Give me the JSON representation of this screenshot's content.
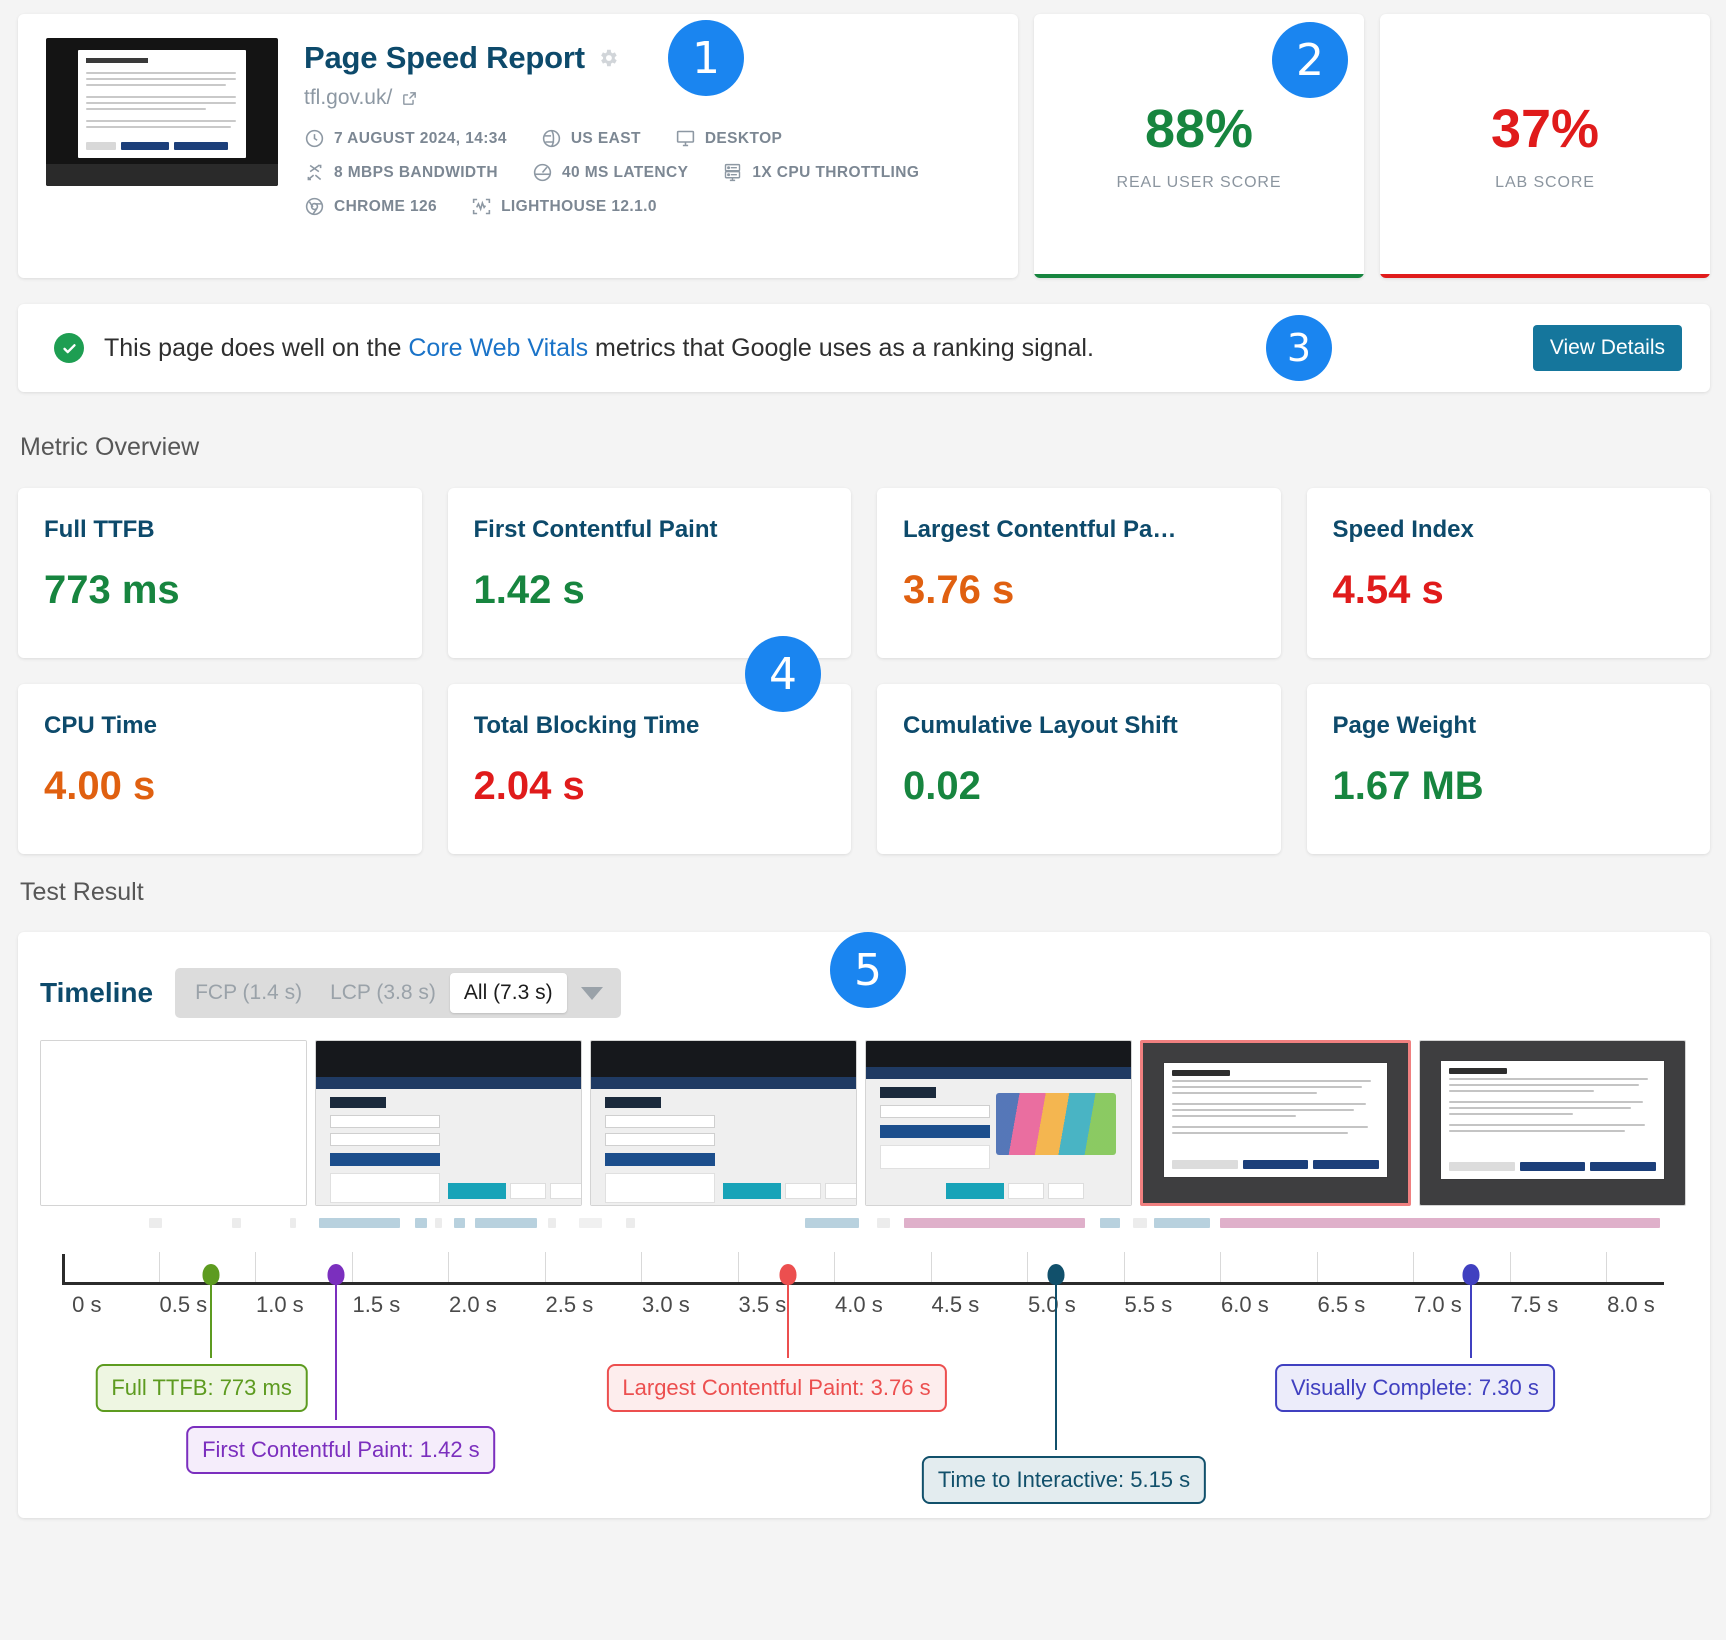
{
  "header": {
    "title": "Page Speed Report",
    "gear_icon": "gear-icon",
    "url": "tfl.gov.uk/",
    "external_icon": "external-link-icon",
    "meta": [
      {
        "icon": "clock-icon",
        "label": "7 AUGUST 2024, 14:34"
      },
      {
        "icon": "globe-icon",
        "label": "US EAST"
      },
      {
        "icon": "monitor-icon",
        "label": "DESKTOP"
      },
      {
        "icon": "bandwidth-icon",
        "label": "8 MBPS BANDWIDTH"
      },
      {
        "icon": "latency-icon",
        "label": "40 MS LATENCY"
      },
      {
        "icon": "cpu-icon",
        "label": "1X CPU THROTTLING"
      },
      {
        "icon": "chrome-icon",
        "label": "CHROME 126"
      },
      {
        "icon": "lighthouse-icon",
        "label": "LIGHTHOUSE 12.1.0"
      }
    ]
  },
  "scores": [
    {
      "value": "88%",
      "label": "REAL USER SCORE",
      "color": "#17853f"
    },
    {
      "value": "37%",
      "label": "LAB SCORE",
      "color": "#e01b1b"
    }
  ],
  "cwv": {
    "text_before": "This page does well on the ",
    "link": "Core Web Vitals",
    "text_after": " metrics that Google uses as a ranking signal.",
    "button": "View Details",
    "check_icon": "check-circle-icon"
  },
  "badges": [
    "1",
    "2",
    "3",
    "4",
    "5"
  ],
  "sections": {
    "metric_overview": "Metric Overview",
    "test_result": "Test Result"
  },
  "metrics": [
    {
      "label": "Full TTFB",
      "value": "773 ms",
      "color": "#17853f"
    },
    {
      "label": "First Contentful Paint",
      "value": "1.42 s",
      "color": "#17853f"
    },
    {
      "label": "Largest Contentful Pa…",
      "value": "3.76 s",
      "color": "#e06010"
    },
    {
      "label": "Speed Index",
      "value": "4.54 s",
      "color": "#e01b1b"
    },
    {
      "label": "CPU Time",
      "value": "4.00 s",
      "color": "#e06010"
    },
    {
      "label": "Total Blocking Time",
      "value": "2.04 s",
      "color": "#e01b1b"
    },
    {
      "label": "Cumulative Layout Shift",
      "value": "0.02",
      "color": "#17853f"
    },
    {
      "label": "Page Weight",
      "value": "1.67 MB",
      "color": "#17853f"
    }
  ],
  "timeline": {
    "title": "Timeline",
    "tabs": [
      {
        "label": "FCP (1.4 s)",
        "active": false
      },
      {
        "label": "LCP (3.8 s)",
        "active": false
      },
      {
        "label": "All (7.3 s)",
        "active": true
      }
    ],
    "caret_icon": "chevron-down-icon"
  },
  "chart_data": {
    "type": "timeline",
    "title": "Timeline",
    "xlabel": "",
    "xlim": [
      0,
      8.3
    ],
    "tick_interval": 0.5,
    "tick_labels": [
      "0 s",
      "0.5 s",
      "1.0 s",
      "1.5 s",
      "2.0 s",
      "2.5 s",
      "3.0 s",
      "3.5 s",
      "4.0 s",
      "4.5 s",
      "5.0 s",
      "5.5 s",
      "6.0 s",
      "6.5 s",
      "7.0 s",
      "7.5 s",
      "8.0 s"
    ],
    "tick_values": [
      0,
      0.5,
      1.0,
      1.5,
      2.0,
      2.5,
      3.0,
      3.5,
      4.0,
      4.5,
      5.0,
      5.5,
      6.0,
      6.5,
      7.0,
      7.5,
      8.0
    ],
    "markers": [
      {
        "name": "Full TTFB",
        "value": 0.773,
        "display": "Full TTFB: 773 ms",
        "color": "#5d9b20",
        "bg": "#eef6e2"
      },
      {
        "name": "First Contentful Paint",
        "value": 1.42,
        "display": "First Contentful Paint: 1.42 s",
        "color": "#7b2fbe",
        "bg": "#f5edfb"
      },
      {
        "name": "Largest Contentful Paint",
        "value": 3.76,
        "display": "Largest Contentful Paint: 3.76 s",
        "color": "#ec4f4f",
        "bg": "#fdeded"
      },
      {
        "name": "Time to Interactive",
        "value": 5.15,
        "display": "Time to Interactive: 5.15 s",
        "color": "#11506b",
        "bg": "#e3ecef"
      },
      {
        "name": "Visually Complete",
        "value": 7.3,
        "display": "Visually Complete: 7.30 s",
        "color": "#4040c0",
        "bg": "#ececfa"
      }
    ],
    "filmstrip_frames": 6,
    "highlighted_frame_index": 4,
    "requests": [
      {
        "start": 0.45,
        "end": 0.52,
        "color": "#ececec"
      },
      {
        "start": 0.88,
        "end": 0.93,
        "color": "#ececec"
      },
      {
        "start": 1.18,
        "end": 1.21,
        "color": "#ececec"
      },
      {
        "start": 1.33,
        "end": 1.75,
        "color": "#b8d1de"
      },
      {
        "start": 1.83,
        "end": 1.89,
        "color": "#b8d1de"
      },
      {
        "start": 1.93,
        "end": 1.97,
        "color": "#ececec"
      },
      {
        "start": 2.03,
        "end": 2.09,
        "color": "#b8d1de"
      },
      {
        "start": 2.14,
        "end": 2.46,
        "color": "#b8d1de"
      },
      {
        "start": 2.52,
        "end": 2.56,
        "color": "#ececec"
      },
      {
        "start": 2.68,
        "end": 2.8,
        "color": "#f0f0f0"
      },
      {
        "start": 2.92,
        "end": 2.97,
        "color": "#ececec"
      },
      {
        "start": 3.85,
        "end": 4.13,
        "color": "#b8d1de"
      },
      {
        "start": 4.22,
        "end": 4.29,
        "color": "#ececec"
      },
      {
        "start": 4.36,
        "end": 5.3,
        "color": "#dfb0ca"
      },
      {
        "start": 5.38,
        "end": 5.48,
        "color": "#b8d1de"
      },
      {
        "start": 5.55,
        "end": 5.62,
        "color": "#ececec"
      },
      {
        "start": 5.66,
        "end": 5.95,
        "color": "#b8d1de"
      },
      {
        "start": 6.0,
        "end": 8.28,
        "color": "#dfb0ca"
      }
    ]
  }
}
